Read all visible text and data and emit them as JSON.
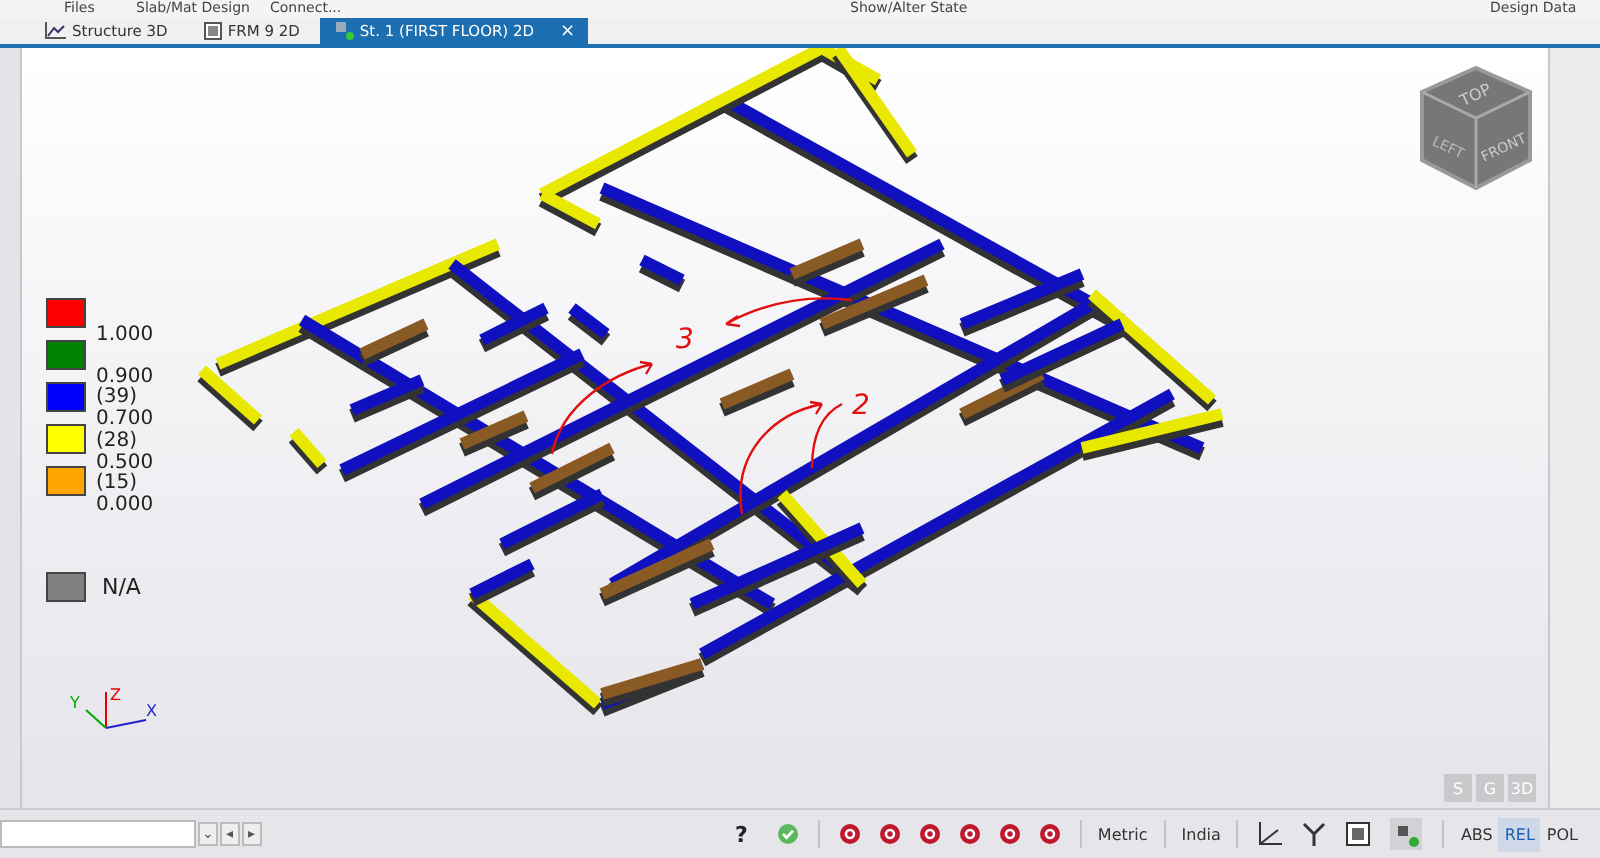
{
  "menu_bar": [
    "Files",
    "Slab/Mat Design",
    "Connect...",
    "Show/Alter State",
    "Design Data"
  ],
  "tabs": [
    {
      "label": "Structure 3D",
      "selected": false
    },
    {
      "label": "FRM 9 2D",
      "selected": false
    },
    {
      "label": "St. 1 (FIRST FLOOR) 2D",
      "selected": true
    }
  ],
  "tab_close": "×",
  "legend": {
    "swatches": [
      {
        "color": "#ff0000"
      },
      {
        "color": "#008000"
      },
      {
        "color": "#0000ff"
      },
      {
        "color": "#ffff00"
      },
      {
        "color": "#ffa500"
      }
    ],
    "labels": [
      "1.000",
      "0.900",
      "(39)",
      "0.700",
      "(28)",
      "0.500",
      "(15)",
      "0.000"
    ],
    "na": {
      "color": "#808080",
      "label": "N/A"
    }
  },
  "annotations": [
    "3",
    "2"
  ],
  "view_cube": {
    "top": "TOP",
    "left": "LEFT",
    "front": "FRONT"
  },
  "axis_triad": {
    "y": "Y",
    "z": "Z",
    "x": "X"
  },
  "view_modes": [
    "S",
    "G",
    "3D"
  ],
  "status_bar": {
    "nav_buttons": [
      "⌄",
      "◂",
      "▸"
    ],
    "help": "?",
    "units": [
      "Metric",
      "India"
    ],
    "coord_modes": [
      {
        "label": "ABS",
        "selected": false
      },
      {
        "label": "REL",
        "selected": true
      },
      {
        "label": "POL",
        "selected": false
      }
    ]
  }
}
